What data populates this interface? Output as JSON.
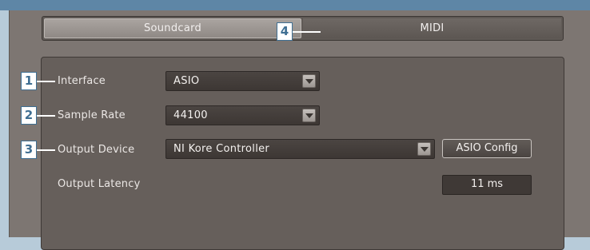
{
  "tabs": [
    {
      "label": "Soundcard",
      "active": true
    },
    {
      "label": "MIDI",
      "active": false
    }
  ],
  "fields": {
    "interface": {
      "label": "Interface",
      "value": "ASIO"
    },
    "sample_rate": {
      "label": "Sample Rate",
      "value": "44100"
    },
    "output_device": {
      "label": "Output Device",
      "value": "NI Kore Controller"
    },
    "output_latency": {
      "label": "Output Latency",
      "value": "11 ms"
    }
  },
  "buttons": {
    "asio_config": "ASIO Config"
  },
  "callouts": [
    "1",
    "2",
    "3",
    "4"
  ],
  "colors": {
    "callout_blue": "#3f6f93",
    "panel_bg": "#665f5b",
    "window_bg": "#7d7672",
    "top_strip": "#5e86a6"
  },
  "icons": {
    "dropdown_arrow": "chevron-down-icon"
  }
}
